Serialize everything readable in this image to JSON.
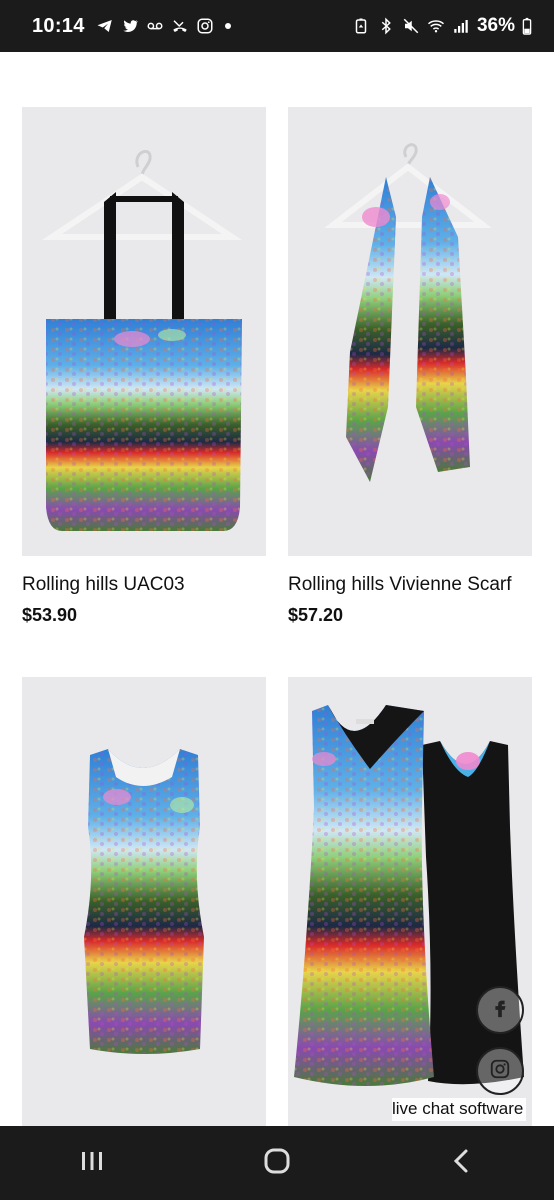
{
  "status_bar": {
    "time": "10:14",
    "battery": "36%",
    "icons_left": [
      "telegram-icon",
      "twitter-icon",
      "voicemail-icon",
      "missed-call-icon",
      "instagram-icon",
      "dot-icon"
    ],
    "icons_right": [
      "battery-saver-icon",
      "bluetooth-icon",
      "mute-icon",
      "wifi-icon",
      "signal-icon",
      "battery-icon"
    ]
  },
  "products": [
    {
      "title": "Rolling hills UAC03",
      "price": "$53.90",
      "image": "tote-bag"
    },
    {
      "title": "Rolling hills Vivienne Scarf",
      "price": "$57.20",
      "image": "scarf"
    },
    {
      "title": "",
      "price": "",
      "image": "fitted-dress"
    },
    {
      "title": "",
      "price": "",
      "image": "reversible-dress"
    }
  ],
  "social_buttons": [
    "facebook-icon",
    "instagram-icon"
  ],
  "live_chat": {
    "label": "live chat software"
  },
  "nav_bar": {
    "buttons": [
      "recent-apps-icon",
      "home-icon",
      "back-icon"
    ]
  }
}
